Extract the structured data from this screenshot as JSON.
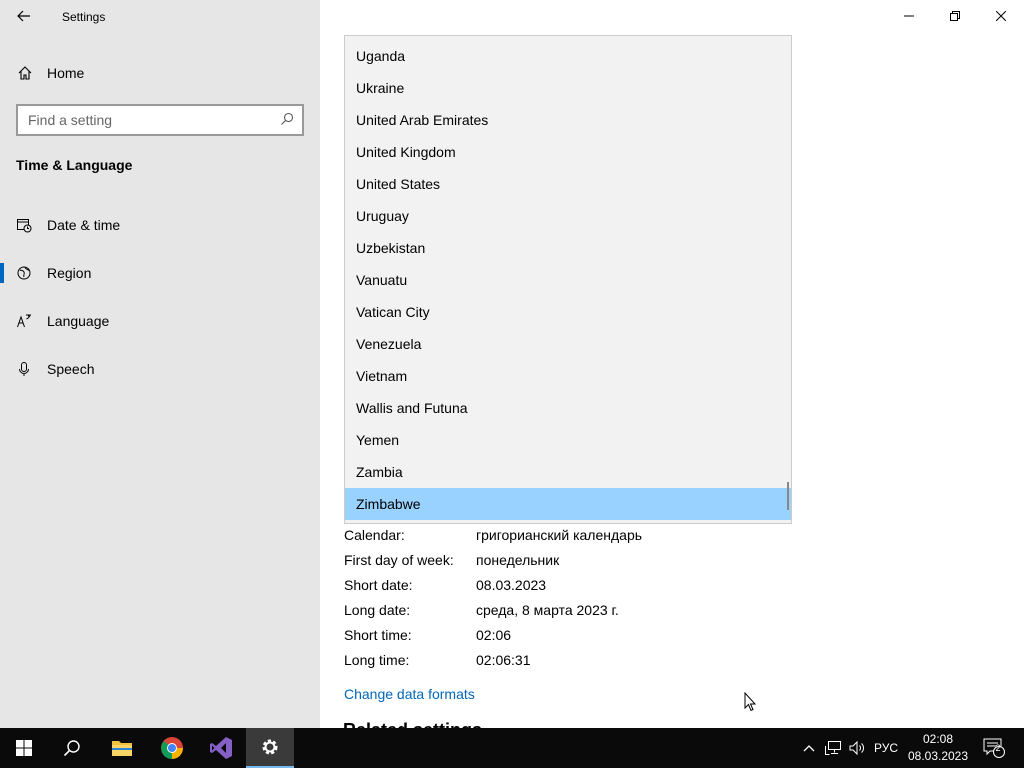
{
  "window": {
    "title": "Settings",
    "back_icon": "back-arrow-icon",
    "minimize_icon": "minimize-icon",
    "restore_icon": "restore-icon",
    "close_icon": "close-icon"
  },
  "sidebar": {
    "home_label": "Home",
    "search_placeholder": "Find a setting",
    "section_title": "Time & Language",
    "items": [
      {
        "label": "Date & time",
        "icon": "date-time-icon",
        "active": false
      },
      {
        "label": "Region",
        "icon": "globe-icon",
        "active": true
      },
      {
        "label": "Language",
        "icon": "language-icon",
        "active": false
      },
      {
        "label": "Speech",
        "icon": "microphone-icon",
        "active": false
      }
    ]
  },
  "dropdown": {
    "options": [
      "Uganda",
      "Ukraine",
      "United Arab Emirates",
      "United Kingdom",
      "United States",
      "Uruguay",
      "Uzbekistan",
      "Vanuatu",
      "Vatican City",
      "Venezuela",
      "Vietnam",
      "Wallis and Futuna",
      "Yemen",
      "Zambia",
      "Zimbabwe"
    ],
    "selected": "Zimbabwe"
  },
  "regional_format": {
    "rows": [
      {
        "key": "Calendar:",
        "value": "григорианский календарь"
      },
      {
        "key": "First day of week:",
        "value": "понедельник"
      },
      {
        "key": "Short date:",
        "value": "08.03.2023"
      },
      {
        "key": "Long date:",
        "value": "среда, 8 марта 2023 г."
      },
      {
        "key": "Short time:",
        "value": "02:06"
      },
      {
        "key": "Long time:",
        "value": "02:06:31"
      }
    ],
    "change_link": "Change data formats",
    "related_heading": "Related settings"
  },
  "taskbar": {
    "apps": [
      "windows-start-icon",
      "search-icon",
      "file-explorer-icon",
      "chrome-icon",
      "visual-studio-icon",
      "settings-gear-icon"
    ],
    "language": "РУС",
    "time": "02:08",
    "date": "08.03.2023",
    "notification_count": "2",
    "colors": {
      "background": "#0a0a0a",
      "active": "#3a3a3a",
      "accent": "#76b9ed"
    }
  },
  "colors": {
    "sidebar_bg": "#e6e6e6",
    "accent": "#0067c0",
    "link": "#0067b8",
    "selection": "#99d1ff",
    "dropdown_bg": "#f2f2f2"
  }
}
